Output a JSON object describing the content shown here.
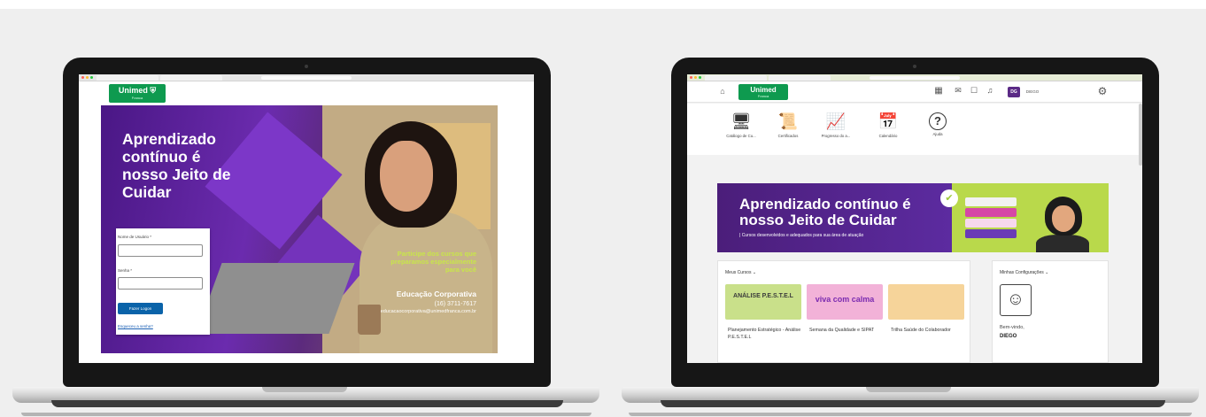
{
  "colors": {
    "unimed_green": "#0e9a4f",
    "purple": "#5c2ba0",
    "lime": "#c8e64a",
    "button_blue": "#0a63a9",
    "background": "#efefef"
  },
  "login_screen": {
    "logo": {
      "text": "Unimed",
      "symbol": "⬡",
      "city": "Franca"
    },
    "hero_title": "Aprendizado contínuo é nosso Jeito de Cuidar",
    "form": {
      "username_label": "Nome de Usuário *",
      "username_value": "",
      "password_label": "Senha *",
      "password_value": "",
      "submit_label": "Fazer Logon",
      "forgot_label": "Esqueceu a senha?"
    },
    "promo": {
      "tagline": "Participe dos cursos que preparamos especialmente para você",
      "brand": "Educação Corporativa",
      "phone": "(16) 3711-7617",
      "email": "educacaocorporativa@unimedfranca.com.br"
    }
  },
  "dashboard_screen": {
    "logo": {
      "text": "Unimed",
      "city": "Franca"
    },
    "topbar": {
      "home_icon": "home-icon",
      "apps_icon": "grid-icon",
      "mail_icon": "mail-icon",
      "chat_icon": "chat-icon",
      "bell_icon": "bell-icon",
      "avatar_initials": "DG",
      "user_name": "DIEGO",
      "settings_icon": "gear-icon"
    },
    "nav": [
      {
        "label": "Catálogo de Cu...",
        "icon": "🖥"
      },
      {
        "label": "Certificados",
        "icon": "📜"
      },
      {
        "label": "Progresso do a...",
        "icon": "📈"
      },
      {
        "label": "Calendário",
        "icon": "📅"
      },
      {
        "label": "Ajuda",
        "icon": "?"
      }
    ],
    "banner": {
      "title": "Aprendizado contínuo é nosso Jeito de Cuidar",
      "subtitle": "| Cursos desenvolvidos e adequados para sua área de atuação"
    },
    "my_courses": {
      "heading": "Meus Cursos",
      "courses": [
        {
          "title": "Planejamento Estratégico - Análise P.E.S.T.E.L",
          "thumb_text": "ANÁLISE P.E.S.T.E.L",
          "thumb_color": "#c9e08a"
        },
        {
          "title": "Semana da Qualidade e SIPAT",
          "thumb_text": "viva com calma",
          "thumb_color": "#f2b2d8"
        },
        {
          "title": "Trilha Saúde do Colaborador",
          "thumb_text": "",
          "thumb_color": "#f6d49a"
        }
      ]
    },
    "settings_panel": {
      "heading": "Minhas Configurações",
      "welcome": "Bem-vindo,",
      "username": "DIEGO"
    }
  }
}
